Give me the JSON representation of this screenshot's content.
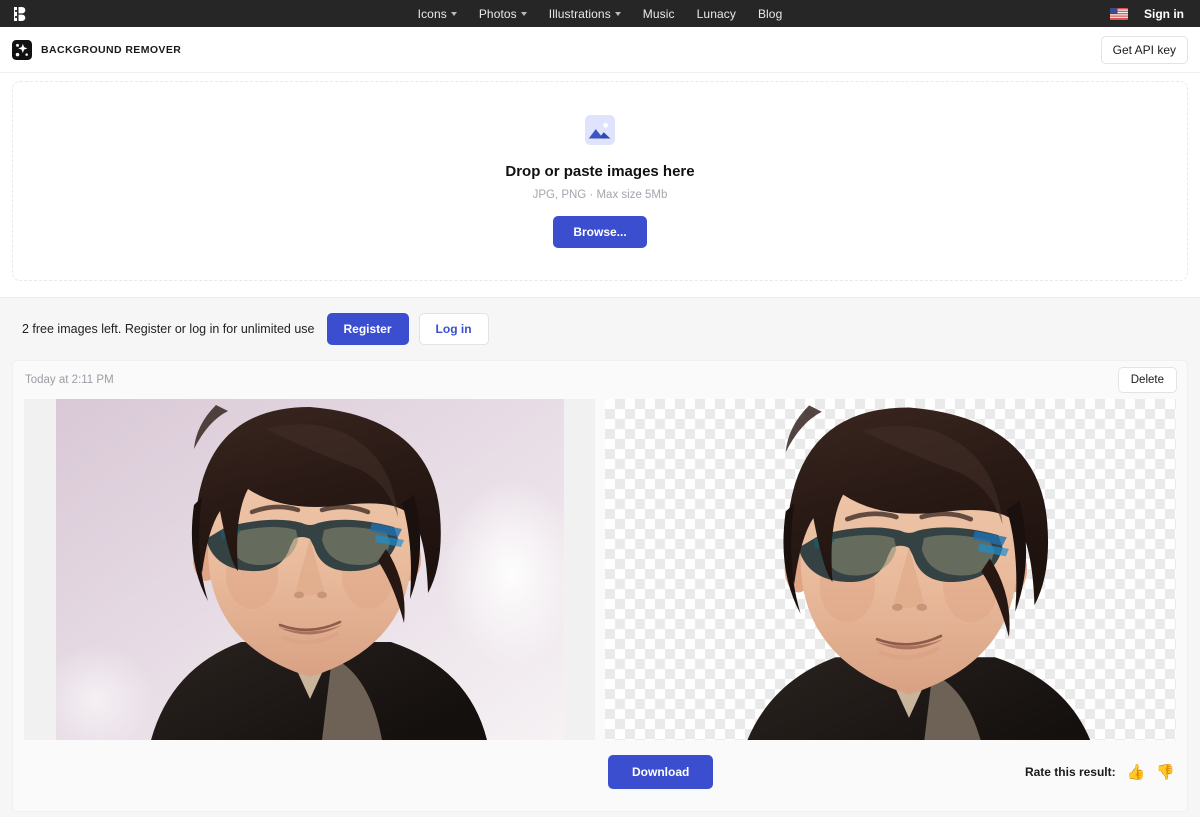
{
  "topbar": {
    "logo_icon": "icons8-logo-icon",
    "nav": [
      {
        "label": "Icons",
        "has_caret": true
      },
      {
        "label": "Photos",
        "has_caret": true
      },
      {
        "label": "Illustrations",
        "has_caret": true
      },
      {
        "label": "Music",
        "has_caret": false
      },
      {
        "label": "Lunacy",
        "has_caret": false
      },
      {
        "label": "Blog",
        "has_caret": false
      }
    ],
    "flag_icon": "us-flag-icon",
    "signin_label": "Sign in"
  },
  "appbar": {
    "brand_icon": "background-remover-logo-icon",
    "brand_name": "BACKGROUND REMOVER",
    "api_key_label": "Get API key"
  },
  "dropzone": {
    "image_icon": "image-placeholder-icon",
    "title": "Drop or paste images here",
    "subtitle": "JPG, PNG · Max size 5Mb",
    "browse_label": "Browse..."
  },
  "freebar": {
    "text": "2 free images left. Register or log in for unlimited use",
    "register_label": "Register",
    "login_label": "Log in"
  },
  "result_card": {
    "timestamp": "Today at 2:11 PM",
    "delete_label": "Delete",
    "original_pane_name": "original-image",
    "result_pane_name": "result-image-transparent",
    "download_label": "Download",
    "rate_label": "Rate this result:",
    "thumbs_up": "👍",
    "thumbs_down": "👎"
  },
  "colors": {
    "accent_blue": "#3b4ed0",
    "topbar_dark": "#262626",
    "section_grey": "#f6f6f7",
    "muted_text": "#a4a6ad"
  }
}
